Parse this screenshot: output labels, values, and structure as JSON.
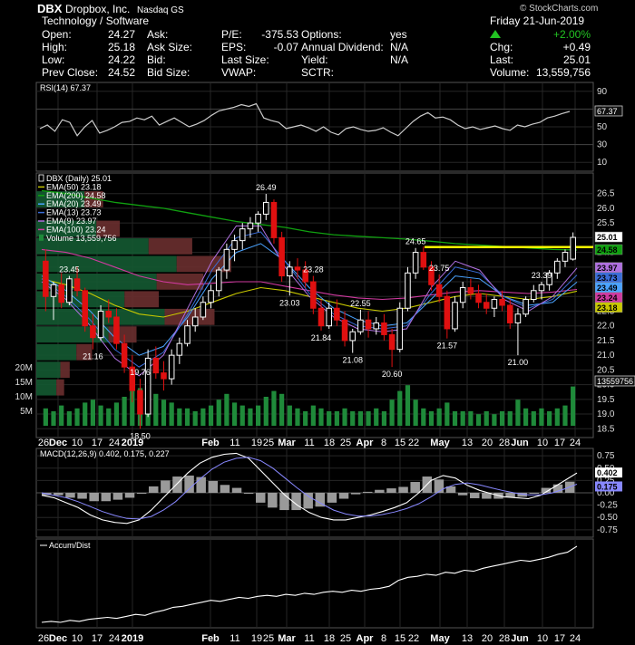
{
  "header": {
    "symbol": "DBX",
    "company": "Dropbox, Inc.",
    "exchange": "Nasdaq GS",
    "watermark": "© StockCharts.com",
    "sector": "Technology / Software",
    "date": "Friday  21-Jun-2019",
    "fields": {
      "open_label": "Open:",
      "open": "24.27",
      "high_label": "High:",
      "high": "25.18",
      "low_label": "Low:",
      "low": "24.22",
      "prev_label": "Prev Close:",
      "prev": "24.52",
      "ask_label": "Ask:",
      "ask": "",
      "asksize_label": "Ask Size:",
      "asksize": "",
      "bid_label": "Bid:",
      "bid": "",
      "bidsize_label": "Bid Size:",
      "bidsize": "",
      "pe_label": "P/E:",
      "pe": "-375.53",
      "eps_label": "EPS:",
      "eps": "-0.07",
      "lastsize_label": "Last Size:",
      "lastsize": "",
      "vwap_label": "VWAP:",
      "vwap": "",
      "options_label": "Options:",
      "options": "yes",
      "dividend_label": "Annual Dividend:",
      "dividend": "N/A",
      "yield_label": "Yield:",
      "yield": "N/A",
      "sctr_label": "SCTR:",
      "sctr": "",
      "pct_change": "+2.00%",
      "chg_label": "Chg:",
      "chg": "+0.49",
      "last_label": "Last:",
      "last": "25.01",
      "volume_label": "Volume:",
      "volume": "13,559,756"
    }
  },
  "colors": {
    "up": "#ffffff",
    "down": "#e01010",
    "rsi": "#cccccc",
    "ema50": "#c8c800",
    "ema200": "#10a010",
    "ema20": "#4aa3ff",
    "ema13": "#3a6dd8",
    "ema9": "#b070e0",
    "ema100": "#d03aa0",
    "volume": "#1f8a3a",
    "hline": "#ffff00",
    "vbp_green": "#145a32",
    "vbp_red": "#6a2f2f",
    "grid": "#262626"
  },
  "chart_data": [
    {
      "type": "line",
      "title": "RSI(14) 67.37",
      "ylim": [
        0,
        100
      ],
      "yticks": [
        "90",
        "70",
        "50",
        "30",
        "10"
      ],
      "last_label": "67.37",
      "values": [
        48,
        52,
        45,
        58,
        55,
        40,
        50,
        57,
        43,
        46,
        50,
        55,
        56,
        60,
        58,
        62,
        52,
        56,
        60,
        55,
        50,
        53,
        57,
        63,
        68,
        70,
        72,
        75,
        73,
        76,
        60,
        57,
        55,
        48,
        50,
        52,
        49,
        45,
        50,
        44,
        41,
        48,
        50,
        47,
        45,
        46,
        49,
        44,
        40,
        48,
        56,
        62,
        66,
        60,
        61,
        58,
        52,
        48,
        50,
        47,
        49,
        51,
        48,
        46,
        52,
        50,
        53,
        55,
        60,
        62,
        65,
        67.37
      ]
    },
    {
      "type": "candlestick",
      "title": "DBX (Daily) 25.01",
      "legend": [
        "DBX (Daily) 25.01",
        "EMA(50) 23.18",
        "EMA(200) 24.58",
        "EMA(20) 23.49",
        "EMA(13) 23.73",
        "EMA(9) 23.97",
        "EMA(100) 23.24",
        "Volume 13,559,756"
      ],
      "ylim": [
        18.2,
        27.2
      ],
      "yticks": [
        "26.5",
        "26.0",
        "25.5",
        "25.0",
        "24.5",
        "24.0",
        "23.5",
        "23.0",
        "22.5",
        "22.0",
        "21.5",
        "21.0",
        "20.5",
        "20.0",
        "19.5",
        "19.0",
        "18.5"
      ],
      "right_labels": [
        {
          "text": "25.01",
          "value": 25.01,
          "color": "#ffffff"
        },
        {
          "text": "24.58",
          "value": 24.58,
          "color": "#10a010"
        },
        {
          "text": "23.97",
          "value": 23.97,
          "color": "#b070e0"
        },
        {
          "text": "23.73",
          "value": 23.73,
          "color": "#3a6dd8"
        },
        {
          "text": "23.49",
          "value": 23.49,
          "color": "#4aa3ff"
        },
        {
          "text": "23.24",
          "value": 23.24,
          "color": "#d03aa0"
        },
        {
          "text": "23.18",
          "value": 23.18,
          "color": "#c8c800"
        }
      ],
      "hline": 24.68,
      "x": [
        "26",
        "Dec",
        "10",
        "17",
        "24",
        "2019",
        "Feb",
        "11",
        "19",
        "25",
        "Mar",
        "11",
        "18",
        "25",
        "Apr",
        "8",
        "15",
        "22",
        "May",
        "13",
        "20",
        "28",
        "Jun",
        "10",
        "17",
        "24"
      ],
      "ohlc": [
        [
          24.2,
          24.6,
          22.5,
          23.0
        ],
        [
          23.0,
          23.5,
          22.2,
          23.4
        ],
        [
          23.4,
          23.8,
          22.6,
          22.8
        ],
        [
          22.8,
          23.7,
          22.7,
          23.6
        ],
        [
          23.6,
          24.0,
          23.0,
          23.2
        ],
        [
          23.2,
          23.3,
          21.8,
          22.0
        ],
        [
          22.0,
          22.4,
          21.2,
          21.6
        ],
        [
          21.6,
          22.7,
          21.5,
          22.5
        ],
        [
          22.5,
          22.9,
          22.1,
          22.3
        ],
        [
          22.3,
          22.6,
          21.2,
          21.4
        ],
        [
          21.4,
          21.7,
          20.4,
          20.6
        ],
        [
          20.6,
          21.0,
          19.4,
          19.8
        ],
        [
          19.8,
          20.2,
          18.5,
          19.0
        ],
        [
          19.0,
          21.2,
          18.9,
          20.9
        ],
        [
          20.9,
          21.3,
          20.2,
          20.4
        ],
        [
          20.4,
          20.8,
          19.8,
          20.2
        ],
        [
          20.2,
          21.2,
          20.0,
          21.0
        ],
        [
          21.0,
          21.6,
          20.7,
          21.4
        ],
        [
          21.4,
          22.2,
          21.3,
          22.0
        ],
        [
          22.0,
          22.6,
          21.8,
          22.3
        ],
        [
          22.3,
          23.0,
          22.2,
          22.8
        ],
        [
          22.8,
          23.4,
          22.6,
          23.2
        ],
        [
          23.2,
          24.0,
          23.0,
          23.9
        ],
        [
          23.9,
          24.8,
          23.6,
          24.6
        ],
        [
          24.6,
          25.1,
          24.2,
          24.9
        ],
        [
          24.9,
          25.5,
          24.6,
          25.3
        ],
        [
          25.3,
          25.7,
          25.0,
          25.5
        ],
        [
          25.5,
          25.9,
          25.2,
          25.8
        ],
        [
          25.8,
          26.49,
          25.6,
          26.2
        ],
        [
          26.2,
          26.3,
          24.8,
          25.0
        ],
        [
          25.0,
          25.2,
          23.5,
          23.7
        ],
        [
          23.7,
          24.2,
          23.03,
          24.0
        ],
        [
          24.0,
          24.3,
          23.6,
          23.9
        ],
        [
          23.9,
          24.2,
          23.3,
          23.5
        ],
        [
          23.5,
          23.7,
          22.4,
          22.6
        ],
        [
          22.6,
          22.9,
          21.84,
          22.0
        ],
        [
          22.0,
          22.8,
          21.9,
          22.6
        ],
        [
          22.6,
          22.9,
          22.0,
          22.2
        ],
        [
          22.2,
          22.5,
          21.3,
          21.5
        ],
        [
          21.5,
          21.9,
          21.08,
          21.8
        ],
        [
          21.8,
          22.55,
          21.7,
          22.2
        ],
        [
          22.2,
          22.5,
          21.6,
          21.9
        ],
        [
          21.9,
          22.3,
          21.7,
          22.1
        ],
        [
          22.1,
          22.4,
          21.5,
          21.7
        ],
        [
          21.7,
          21.9,
          20.6,
          21.2
        ],
        [
          21.2,
          22.8,
          21.1,
          22.6
        ],
        [
          22.6,
          24.0,
          22.5,
          23.8
        ],
        [
          23.8,
          24.65,
          23.6,
          24.5
        ],
        [
          24.5,
          24.7,
          23.9,
          24.0
        ],
        [
          24.0,
          24.2,
          23.2,
          23.4
        ],
        [
          23.4,
          23.75,
          22.8,
          23.0
        ],
        [
          23.0,
          23.2,
          21.57,
          21.9
        ],
        [
          21.9,
          23.0,
          21.8,
          22.8
        ],
        [
          22.8,
          23.5,
          22.6,
          23.3
        ],
        [
          23.3,
          23.6,
          22.9,
          23.1
        ],
        [
          23.1,
          23.4,
          22.6,
          22.8
        ],
        [
          22.8,
          23.1,
          22.4,
          22.6
        ],
        [
          22.6,
          23.0,
          22.3,
          22.9
        ],
        [
          22.9,
          23.2,
          22.5,
          22.7
        ],
        [
          22.7,
          22.9,
          21.9,
          22.1
        ],
        [
          22.1,
          22.6,
          21.0,
          22.4
        ],
        [
          22.4,
          23.0,
          22.3,
          22.9
        ],
        [
          22.9,
          23.39,
          22.8,
          23.2
        ],
        [
          23.2,
          23.5,
          22.9,
          23.4
        ],
        [
          23.4,
          23.9,
          23.2,
          23.8
        ],
        [
          23.8,
          24.3,
          23.6,
          24.2
        ],
        [
          24.2,
          24.6,
          24.0,
          24.5
        ],
        [
          24.27,
          25.18,
          24.22,
          25.01
        ]
      ],
      "annotations": [
        [
          "26.49",
          28
        ],
        [
          "24.65",
          47
        ],
        [
          "23.45",
          3
        ],
        [
          "23.28",
          34
        ],
        [
          "23.03",
          31
        ],
        [
          "22.55",
          40
        ],
        [
          "23.75",
          50
        ],
        [
          "23.39",
          63
        ],
        [
          "21.16",
          6
        ],
        [
          "19.76",
          12
        ],
        [
          "18.50",
          12
        ],
        [
          "21.84",
          35
        ],
        [
          "21.08",
          39
        ],
        [
          "20.60",
          44
        ],
        [
          "21.57",
          51
        ],
        [
          "21.00",
          60
        ]
      ],
      "ema200": [
        26.6,
        26.5,
        26.35,
        26.2,
        26.1,
        26.0,
        25.85,
        25.7,
        25.55,
        25.45,
        25.35,
        25.2,
        25.1,
        25.05,
        25.0,
        24.95,
        24.88,
        24.8,
        24.75,
        24.7,
        24.65,
        24.6,
        24.58
      ],
      "ema50": [
        23.6,
        23.4,
        23.1,
        22.7,
        22.4,
        22.3,
        22.5,
        22.8,
        23.1,
        23.3,
        23.2,
        23.0,
        22.8,
        22.6,
        22.5,
        22.6,
        22.8,
        23.0,
        23.1,
        23.0,
        22.9,
        23.0,
        23.18
      ],
      "ema100": [
        24.6,
        24.5,
        24.3,
        24.0,
        23.7,
        23.5,
        23.4,
        23.45,
        23.5,
        23.5,
        23.35,
        23.2,
        23.05,
        22.95,
        22.9,
        22.95,
        23.05,
        23.15,
        23.2,
        23.15,
        23.1,
        23.15,
        23.24
      ],
      "ema20": [
        23.7,
        23.2,
        22.5,
        21.6,
        21.0,
        21.3,
        22.3,
        23.6,
        24.5,
        24.8,
        24.2,
        23.3,
        22.6,
        22.2,
        22.0,
        22.1,
        22.9,
        23.7,
        23.6,
        23.0,
        22.7,
        22.8,
        23.49
      ],
      "ema13": [
        23.6,
        23.0,
        22.2,
        21.2,
        20.6,
        21.1,
        22.4,
        23.9,
        25.0,
        25.2,
        24.2,
        23.1,
        22.4,
        22.0,
        21.9,
        22.0,
        23.1,
        24.0,
        23.8,
        23.0,
        22.6,
        22.9,
        23.73
      ],
      "ema9": [
        23.5,
        22.9,
        22.0,
        20.9,
        20.3,
        21.0,
        22.6,
        24.2,
        25.4,
        25.4,
        24.0,
        23.0,
        22.3,
        21.9,
        21.8,
        21.9,
        23.3,
        24.2,
        23.9,
        22.9,
        22.5,
        23.0,
        23.97
      ]
    },
    {
      "type": "bar",
      "title": "Volume 13,559,756",
      "yticks": [
        "20M",
        "15M",
        "10M",
        "5M"
      ],
      "ylim": [
        0,
        25
      ],
      "last_label": "13559756",
      "values": [
        6,
        5,
        7,
        5,
        6,
        8,
        9,
        7,
        6,
        8,
        10,
        12,
        13,
        15,
        11,
        9,
        8,
        6,
        6,
        5,
        6,
        7,
        9,
        11,
        8,
        7,
        6,
        7,
        10,
        12,
        11,
        7,
        6,
        5,
        7,
        6,
        5,
        5,
        6,
        5,
        5,
        5,
        6,
        5,
        9,
        12,
        14,
        9,
        6,
        5,
        6,
        8,
        5,
        5,
        5,
        4,
        5,
        4,
        5,
        5,
        9,
        6,
        5,
        6,
        5,
        6,
        7,
        13.56
      ]
    },
    {
      "type": "line",
      "title": "MACD(12,26,9) 0.402, 0.175, 0.227",
      "ylim": [
        -0.9,
        0.9
      ],
      "yticks": [
        "0.75",
        "0.50",
        "0.25",
        "0.00",
        "-0.25",
        "-0.50",
        "-0.75"
      ],
      "right_labels": [
        "0.402",
        "0.175"
      ],
      "macd": [
        -0.05,
        -0.1,
        -0.2,
        -0.3,
        -0.45,
        -0.55,
        -0.6,
        -0.62,
        -0.55,
        -0.35,
        -0.1,
        0.15,
        0.4,
        0.6,
        0.72,
        0.78,
        0.8,
        0.7,
        0.45,
        0.2,
        -0.05,
        -0.25,
        -0.4,
        -0.5,
        -0.55,
        -0.55,
        -0.5,
        -0.45,
        -0.38,
        -0.3,
        -0.2,
        0.0,
        0.25,
        0.35,
        0.3,
        0.15,
        0.05,
        -0.02,
        -0.08,
        -0.1,
        -0.12,
        -0.05,
        0.1,
        0.25,
        0.402
      ],
      "signal": [
        0.0,
        -0.05,
        -0.1,
        -0.18,
        -0.28,
        -0.38,
        -0.46,
        -0.52,
        -0.53,
        -0.48,
        -0.35,
        -0.18,
        0.05,
        0.28,
        0.48,
        0.62,
        0.7,
        0.72,
        0.65,
        0.5,
        0.3,
        0.1,
        -0.08,
        -0.22,
        -0.35,
        -0.43,
        -0.47,
        -0.47,
        -0.44,
        -0.39,
        -0.32,
        -0.22,
        -0.08,
        0.08,
        0.17,
        0.2,
        0.16,
        0.1,
        0.04,
        -0.01,
        -0.04,
        -0.04,
        0.0,
        0.08,
        0.175
      ],
      "histogram": [
        -0.05,
        -0.05,
        -0.1,
        -0.12,
        -0.17,
        -0.17,
        -0.14,
        -0.1,
        -0.02,
        0.13,
        0.25,
        0.33,
        0.35,
        0.32,
        0.24,
        0.16,
        0.1,
        -0.02,
        -0.2,
        -0.3,
        -0.35,
        -0.35,
        -0.32,
        -0.28,
        -0.2,
        -0.12,
        -0.03,
        0.02,
        0.06,
        0.09,
        0.12,
        0.22,
        0.33,
        0.27,
        0.13,
        -0.05,
        -0.11,
        -0.12,
        -0.12,
        -0.09,
        -0.08,
        -0.01,
        0.1,
        0.17,
        0.227
      ]
    },
    {
      "type": "line",
      "title": "Accum/Dist",
      "values": [
        10,
        11,
        10,
        12,
        11,
        13,
        14,
        15,
        14,
        16,
        18,
        17,
        20,
        22,
        25,
        26,
        28,
        30,
        32,
        31,
        33,
        35,
        34,
        36,
        37,
        36,
        38,
        37,
        39,
        38,
        40,
        41,
        40,
        42,
        41,
        43,
        44,
        46,
        52,
        55,
        56,
        58,
        57,
        60,
        59,
        62,
        61,
        64,
        66,
        68,
        70,
        72,
        71,
        73,
        75,
        78,
        80,
        86
      ]
    }
  ]
}
